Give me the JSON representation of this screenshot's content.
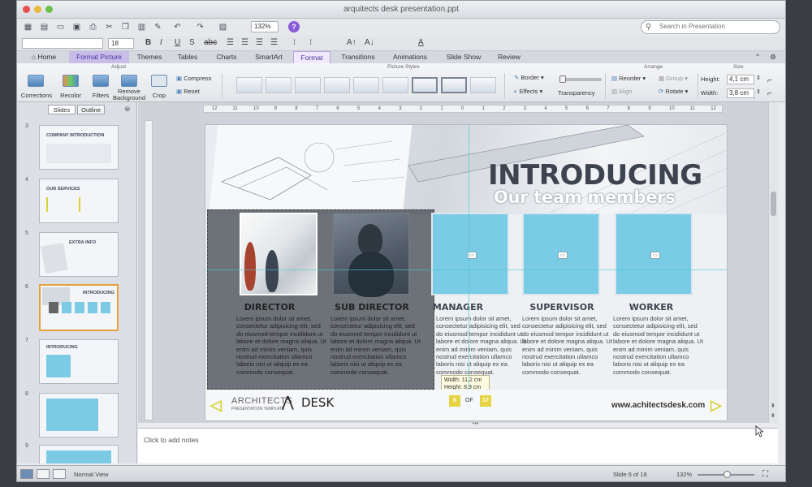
{
  "window": {
    "title": "arquitects desk presentation.ppt"
  },
  "toolbar": {
    "zoom": "132%",
    "search_placeholder": "Search in Presentation"
  },
  "formatbar": {
    "font_size": "18"
  },
  "tabs": [
    {
      "label": "Home"
    },
    {
      "label": "Format Picture"
    },
    {
      "label": "Themes"
    },
    {
      "label": "Tables"
    },
    {
      "label": "Charts"
    },
    {
      "label": "SmartArt"
    },
    {
      "label": "Format"
    },
    {
      "label": "Transitions"
    },
    {
      "label": "Animations"
    },
    {
      "label": "Slide Show"
    },
    {
      "label": "Review"
    }
  ],
  "ribbon": {
    "groups": {
      "adjust": "Adjust",
      "picture_styles": "Picture Styles",
      "arrange": "Arrange",
      "size": "Size"
    },
    "corrections": "Corrections",
    "recolor": "Recolor",
    "filters": "Filters",
    "remove_background": "Remove Background",
    "crop": "Crop",
    "compress": "Compress",
    "reset": "Reset",
    "border": "Border",
    "effects": "Effects",
    "transparency": "Transparency",
    "reorder": "Reorder",
    "align": "Align",
    "group": "Group",
    "rotate": "Rotate",
    "height_label": "Height:",
    "height_value": "4,1 cm",
    "width_label": "Width:",
    "width_value": "3,8 cm"
  },
  "slide_pane": {
    "tab_slides": "Slides",
    "tab_outline": "Outline",
    "thumbs": [
      {
        "num": "3",
        "text": "COMPANY INTRODUCTION"
      },
      {
        "num": "4",
        "text": "OUR SERVICES"
      },
      {
        "num": "5",
        "text": "EXTRA INFO"
      },
      {
        "num": "6",
        "text": "INTRODUCING"
      },
      {
        "num": "7",
        "text": "INTRODUCING"
      },
      {
        "num": "8",
        "text": ""
      },
      {
        "num": "9",
        "text": ""
      }
    ]
  },
  "ruler": {
    "ticks": [
      "12",
      "11",
      "10",
      "9",
      "8",
      "7",
      "6",
      "5",
      "4",
      "3",
      "2",
      "1",
      "0",
      "1",
      "2",
      "3",
      "4",
      "5",
      "6",
      "7",
      "8",
      "9",
      "10",
      "11",
      "12"
    ]
  },
  "slide": {
    "headline": "INTRODUCING",
    "subhead": "Our team members",
    "cards": [
      {
        "title": "DIRECTOR",
        "body": "Lorem ipsum dolor sit amet, consectetur adipisicing elit, sed do eiusmod tempor incididunt ut labore et dolore magna aliqua. Ut enim ad minim veniam, quis nostrud exercitation ullamco laboris nisi ut aliquip ex ea commodo consequat."
      },
      {
        "title": "SUB DIRECTOR",
        "body": "Lorem ipsum dolor sit amet, consectetur adipisicing elit, sed do eiusmod tempor incididunt ut labore et dolore magna aliqua. Ut enim ad minim veniam, quis nostrud exercitation ullamco laboris nisi ut aliquip ex ea commodo consequat."
      },
      {
        "title": "MANAGER",
        "body": "Lorem ipsum dolor sit amet, consectetur adipisicing elit, sed do eiusmod tempor incididunt ut labore et dolore magna aliqua. Ut enim ad minim veniam, quis nostrud exercitation ullamco laboris nisi ut aliquip ex ea commodo consequat."
      },
      {
        "title": "SUPERVISOR",
        "body": "Lorem ipsum dolor sit amet, consectetur adipisicing elit, sed do eiusmod tempor incididunt ut labore et dolore magna aliqua. Ut enim ad minim veniam, quis nostrud exercitation ullamco laboris nisi ut aliquip ex ea commodo consequat."
      },
      {
        "title": "WORKER",
        "body": "Lorem ipsum dolor sit amet, consectetur adipisicing elit, sed do eiusmod tempor incididunt ut labore et dolore magna aliqua. Ut enim ad minim veniam, quis nostrud exercitation ullamco laboris nisi ut aliquip ex ea commodo consequat."
      }
    ],
    "dim_width": "Width: 11,2 cm",
    "dim_height": "Height: 8,9 cm",
    "logo_main": "ARCHITECTS",
    "logo_sub": "PRESENTATION TEMPLATE",
    "logo_desk": "DESK",
    "page_current": "6",
    "page_of": "OF",
    "page_total": "17",
    "website": "www.achitectsdesk.com"
  },
  "notes": {
    "placeholder": "Click to add notes"
  },
  "status": {
    "view": "Normal View",
    "slide_count": "Slide 6 of 18",
    "zoom": "132%"
  },
  "colors": {
    "accent_purple": "#8a5bd6",
    "card_blue": "#79cbe6",
    "arrow_yellow": "#d8d23a",
    "selection_orange": "#e3a23a"
  }
}
